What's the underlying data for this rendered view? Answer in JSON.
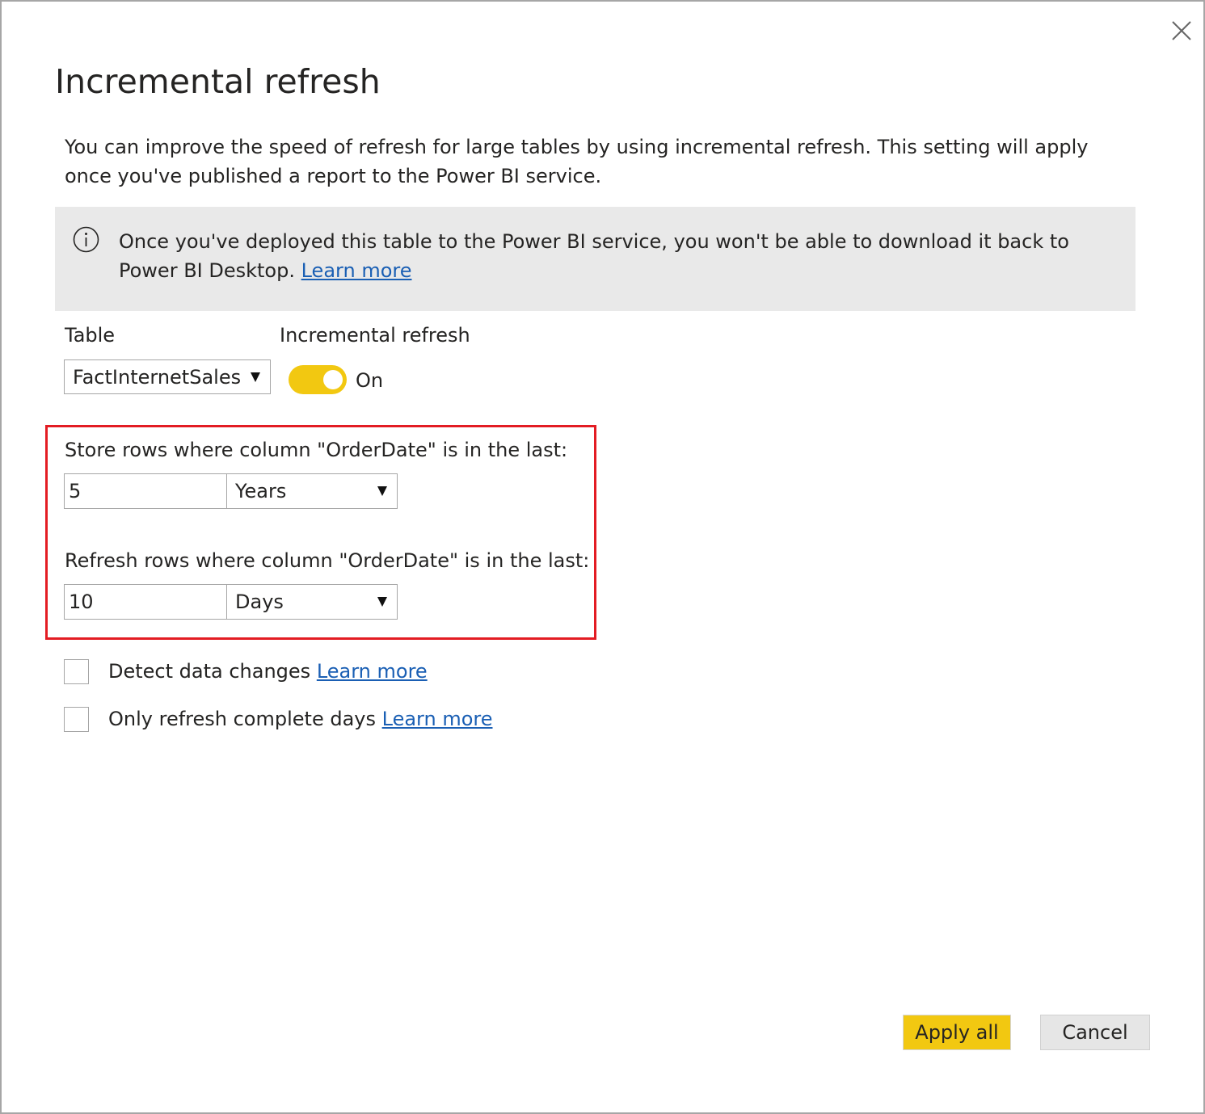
{
  "dialog": {
    "title": "Incremental refresh",
    "description": "You can improve the speed of refresh for large tables by using incremental refresh. This setting will apply once you've published a report to the Power BI service.",
    "close_icon": "close-icon"
  },
  "info_banner": {
    "icon": "info-icon",
    "text": "Once you've deployed this table to the Power BI service, you won't be able to download it back to Power BI Desktop.",
    "link": "Learn more"
  },
  "table": {
    "label": "Table",
    "selected": "FactInternetSales"
  },
  "incremental_refresh": {
    "label": "Incremental refresh",
    "state_label": "On",
    "enabled": true
  },
  "store_rows": {
    "label": "Store rows where column \"OrderDate\" is in the last:",
    "value": "5",
    "unit": "Years"
  },
  "refresh_rows": {
    "label": "Refresh rows where column \"OrderDate\" is in the last:",
    "value": "10",
    "unit": "Days"
  },
  "options": {
    "detect_changes": {
      "label": "Detect data changes",
      "link": "Learn more",
      "checked": false
    },
    "complete_days": {
      "label": "Only refresh complete days",
      "link": "Learn more",
      "checked": false
    }
  },
  "buttons": {
    "apply": "Apply all",
    "cancel": "Cancel"
  },
  "colors": {
    "accent_yellow": "#f2c811",
    "highlight_red": "#e31c23",
    "banner_bg": "#e9e9e9",
    "link_blue": "#1a5fb4"
  }
}
